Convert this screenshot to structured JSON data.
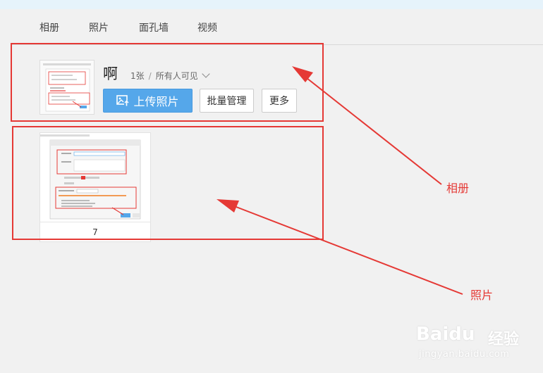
{
  "nav": {
    "items": [
      {
        "label": "相册"
      },
      {
        "label": "照片"
      },
      {
        "label": "面孔墙"
      },
      {
        "label": "视频"
      }
    ]
  },
  "album": {
    "title": "啊",
    "count": "1张",
    "visibility": "所有人可见",
    "upload_label": "上传照片",
    "batch_label": "批量管理",
    "more_label": "更多"
  },
  "photo": {
    "caption": "7"
  },
  "annotations": {
    "album_label": "相册",
    "photo_label": "照片"
  },
  "watermark": {
    "brand": "Baidu",
    "cn": "经验",
    "url": "jingyan.baidu.com"
  },
  "colors": {
    "accent": "#55a7ea",
    "annotation": "#e53935",
    "topbar": "#e6f3fb"
  }
}
